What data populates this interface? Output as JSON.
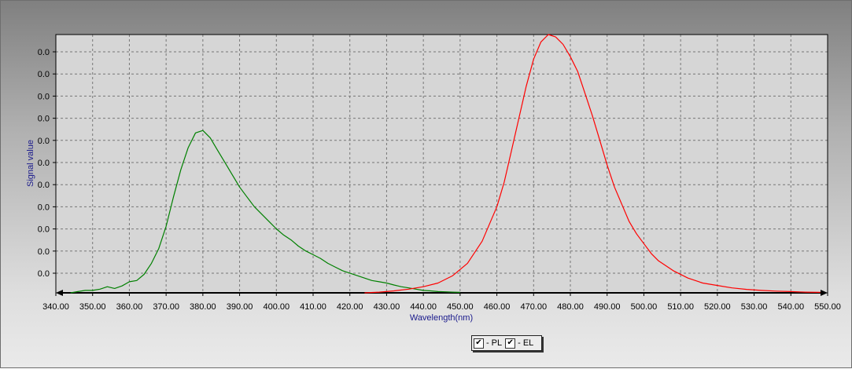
{
  "chart_data": {
    "type": "line",
    "title": "",
    "xlabel": "Wavelength(nm)",
    "ylabel": "Signal value",
    "xlim": [
      340,
      550
    ],
    "ylim": [
      0,
      1.05
    ],
    "grid": true,
    "legend_placement": "bottom-center",
    "x_tick_labels": [
      "340.00",
      "350.00",
      "360.00",
      "370.00",
      "380.00",
      "390.00",
      "400.00",
      "410.00",
      "420.00",
      "430.00",
      "440.00",
      "450.00",
      "460.00",
      "470.00",
      "480.00",
      "490.00",
      "500.00",
      "510.00",
      "520.00",
      "530.00",
      "540.00",
      "550.00"
    ],
    "y_tick_labels": [
      "0.0",
      "0.0",
      "0.0",
      "0.0",
      "0.0",
      "0.0",
      "0.0",
      "0.0",
      "0.0",
      "0.0",
      "0.0"
    ],
    "series": [
      {
        "name": "PL",
        "color": "#008000",
        "x": [
          344,
          346,
          348,
          350,
          352,
          354,
          356,
          358,
          360,
          362,
          364,
          366,
          368,
          370,
          372,
          374,
          376,
          378,
          380,
          382,
          384,
          386,
          388,
          390,
          392,
          394,
          396,
          398,
          400,
          402,
          404,
          406,
          408,
          410,
          412,
          414,
          416,
          418,
          420,
          422,
          424,
          426,
          428,
          430,
          432,
          434,
          436,
          438,
          440,
          442,
          444,
          446,
          448,
          450
        ],
        "y": [
          0.0,
          0.005,
          0.01,
          0.01,
          0.015,
          0.025,
          0.018,
          0.028,
          0.045,
          0.05,
          0.075,
          0.12,
          0.18,
          0.27,
          0.39,
          0.5,
          0.59,
          0.65,
          0.66,
          0.63,
          0.58,
          0.53,
          0.48,
          0.43,
          0.39,
          0.35,
          0.32,
          0.29,
          0.26,
          0.235,
          0.215,
          0.19,
          0.17,
          0.155,
          0.14,
          0.12,
          0.105,
          0.09,
          0.08,
          0.07,
          0.06,
          0.05,
          0.045,
          0.04,
          0.032,
          0.025,
          0.02,
          0.015,
          0.01,
          0.008,
          0.005,
          0.004,
          0.003,
          0.002
        ]
      },
      {
        "name": "EL",
        "color": "#ff0000",
        "x": [
          424,
          428,
          432,
          436,
          440,
          444,
          448,
          452,
          456,
          460,
          462,
          464,
          466,
          468,
          470,
          472,
          474,
          476,
          478,
          480,
          482,
          484,
          486,
          488,
          490,
          492,
          494,
          496,
          498,
          500,
          502,
          504,
          508,
          512,
          516,
          520,
          524,
          528,
          532,
          536,
          540,
          544,
          548
        ],
        "y": [
          0.0,
          0.003,
          0.008,
          0.015,
          0.025,
          0.04,
          0.07,
          0.12,
          0.21,
          0.35,
          0.45,
          0.58,
          0.71,
          0.84,
          0.95,
          1.02,
          1.05,
          1.04,
          1.01,
          0.96,
          0.9,
          0.81,
          0.72,
          0.62,
          0.52,
          0.43,
          0.36,
          0.29,
          0.24,
          0.2,
          0.16,
          0.13,
          0.09,
          0.06,
          0.04,
          0.03,
          0.02,
          0.014,
          0.01,
          0.007,
          0.005,
          0.003,
          0.002
        ]
      }
    ]
  },
  "legend": {
    "items": [
      {
        "label": "PL",
        "checked": true,
        "check_glyph": "✔",
        "dash": "-"
      },
      {
        "label": "EL",
        "checked": true,
        "check_glyph": "✔",
        "dash": "-"
      }
    ]
  }
}
